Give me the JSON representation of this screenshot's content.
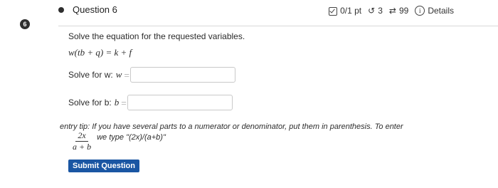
{
  "question": {
    "number": "6",
    "title": "Question 6",
    "score": "0/1 pt",
    "retries": "3",
    "attempts": "99",
    "details_label": "Details"
  },
  "prompt": "Solve the equation for the requested variables.",
  "equation": "w(tb + q) = k + f",
  "fields": [
    {
      "label": "Solve for w:",
      "var": "w",
      "value": ""
    },
    {
      "label": "Solve for b:",
      "var": "b",
      "value": ""
    }
  ],
  "tip": {
    "lead": "entry tip:",
    "text": "If you have several parts to a numerator or denominator, put them in parenthesis. To enter",
    "frac_num": "2x",
    "frac_den": "a + b",
    "example": "we type \"(2x)/(a+b)\""
  },
  "submit_label": "Submit Question",
  "colors": {
    "accent": "#1a56a3"
  }
}
